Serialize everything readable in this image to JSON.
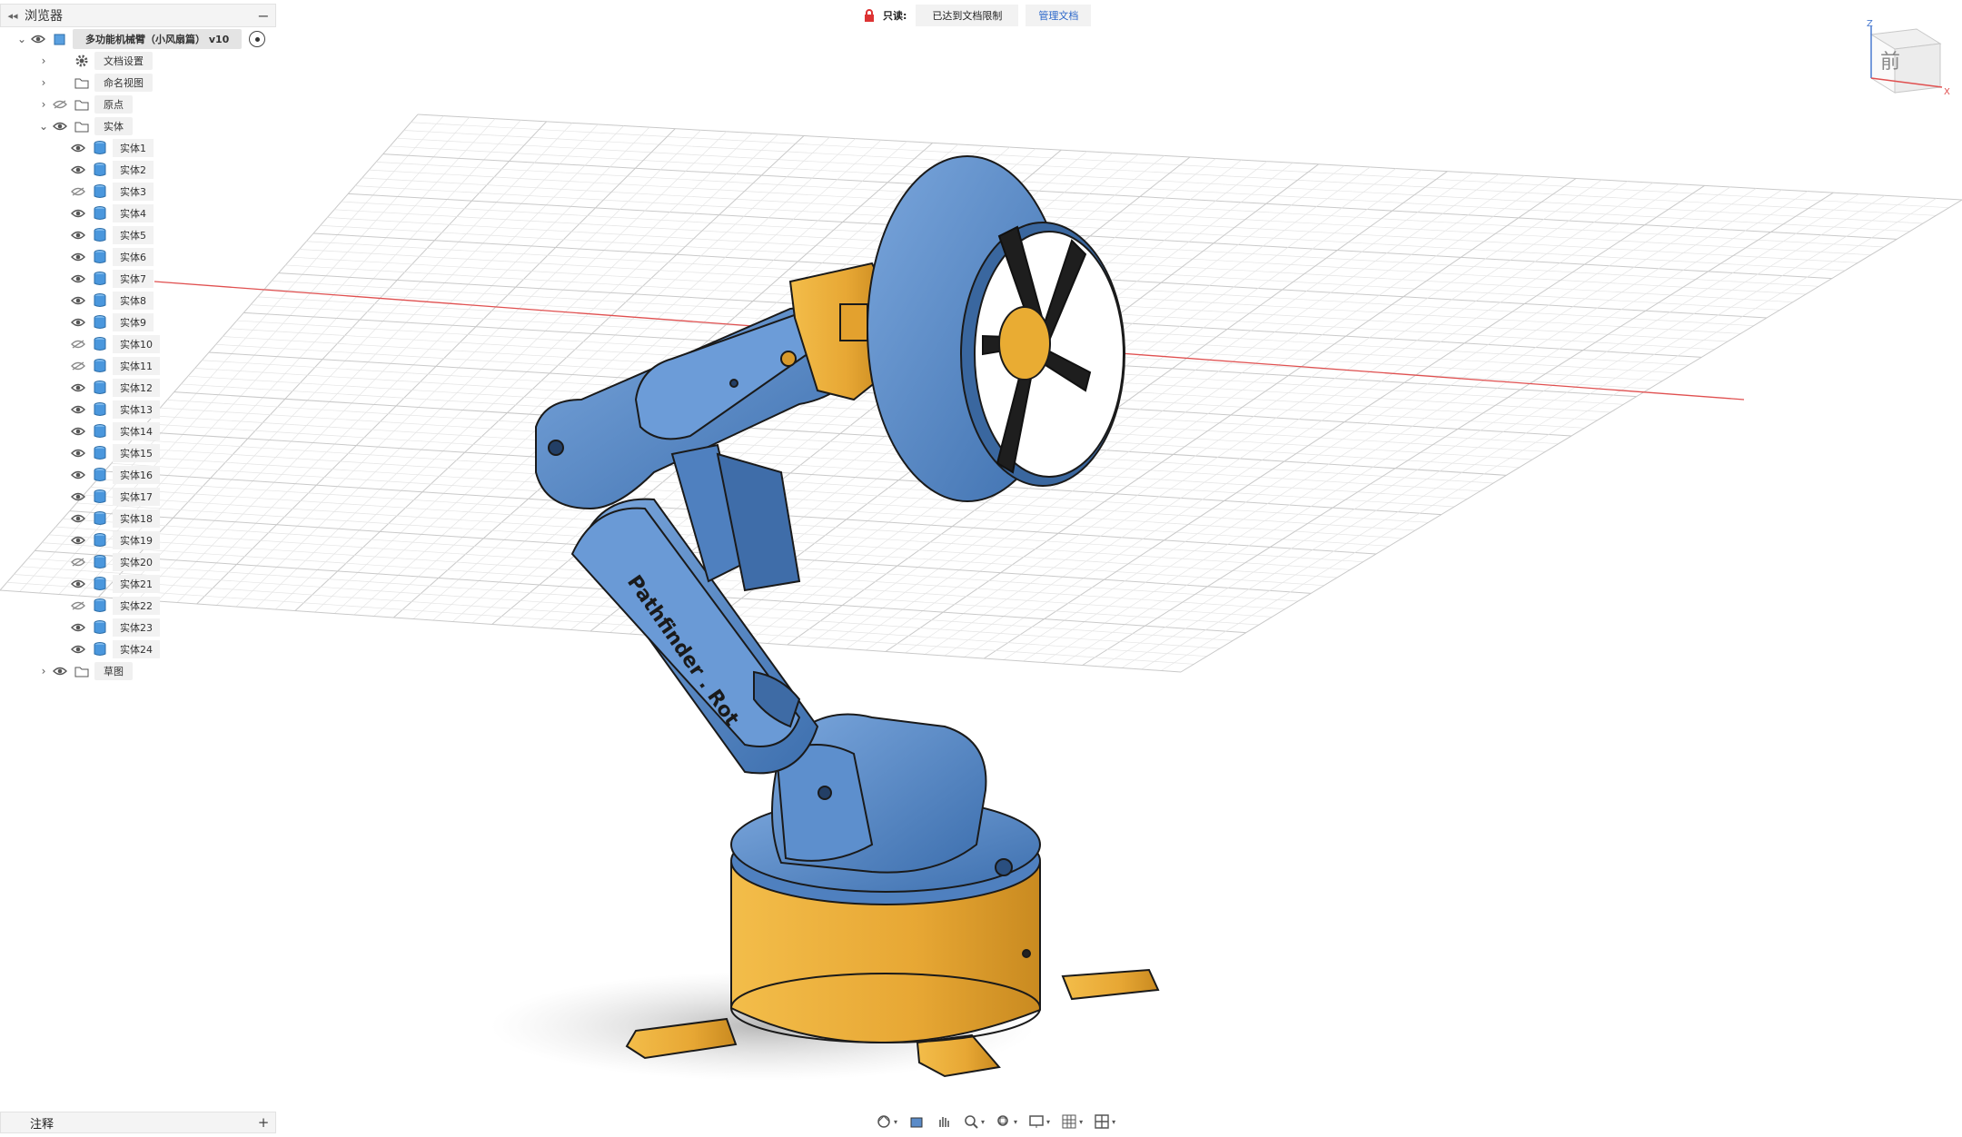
{
  "browser": {
    "title": "浏览器",
    "collapse_icon": "double-chevron-left-icon",
    "root": {
      "label": "多功能机械臂（小风扇篇） v10"
    },
    "nodes": [
      {
        "label": "文档设置",
        "icon": "gear-icon"
      },
      {
        "label": "命名视图",
        "icon": "folder-icon"
      },
      {
        "label": "原点",
        "icon": "folder-icon"
      },
      {
        "label": "实体",
        "icon": "folder-icon"
      },
      {
        "label": "草图",
        "icon": "folder-icon"
      }
    ],
    "bodies": [
      "实体1",
      "实体2",
      "实体3",
      "实体4",
      "实体5",
      "实体6",
      "实体7",
      "实体8",
      "实体9",
      "实体10",
      "实体11",
      "实体12",
      "实体13",
      "实体14",
      "实体15",
      "实体16",
      "实体17",
      "实体18",
      "实体19",
      "实体20",
      "实体21",
      "实体22",
      "实体23",
      "实体24"
    ]
  },
  "banner": {
    "readonly_label": "只读:",
    "message": "已达到文档限制",
    "manage_label": "管理文档"
  },
  "model": {
    "engraving": "Pathfinder . Rot"
  },
  "viewcube": {
    "face": "前",
    "axis_z": "Z",
    "axis_x": "X"
  },
  "notes": {
    "title": "注释",
    "add": "+"
  },
  "toolbar": {
    "icons": [
      "orbit-icon",
      "look-at-icon",
      "pan-icon",
      "zoom-icon",
      "fit-icon",
      "display-settings-icon",
      "grid-icon",
      "viewports-icon"
    ]
  },
  "colors": {
    "blue_part": "#5a8bc8",
    "yellow_part": "#e8a93a",
    "grid": "#d9d9d9",
    "axis_red": "#e05050"
  }
}
